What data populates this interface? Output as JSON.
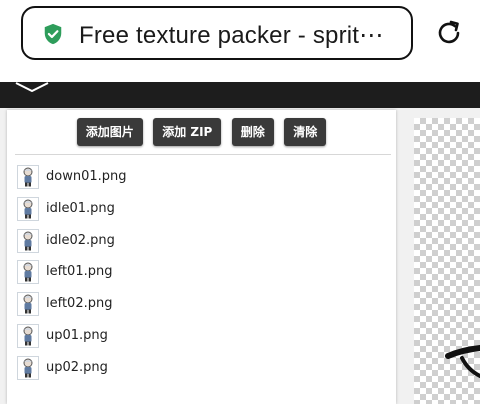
{
  "browser": {
    "url_text": "Free texture packer - sprit⋯",
    "secure_icon": "shield-check-icon",
    "reload_icon": "reload-icon"
  },
  "toolbar": {
    "add_image_label": "添加图片",
    "add_zip_label": "添加 ZIP",
    "delete_label": "删除",
    "clear_label": "清除"
  },
  "files": [
    {
      "name": "down01.png"
    },
    {
      "name": "idle01.png"
    },
    {
      "name": "idle02.png"
    },
    {
      "name": "left01.png"
    },
    {
      "name": "left02.png"
    },
    {
      "name": "up01.png"
    },
    {
      "name": "up02.png"
    }
  ],
  "colors": {
    "button_bg": "#3a3a3a",
    "shield_green": "#2e9d5b",
    "header_dark": "#1d1d1d"
  }
}
